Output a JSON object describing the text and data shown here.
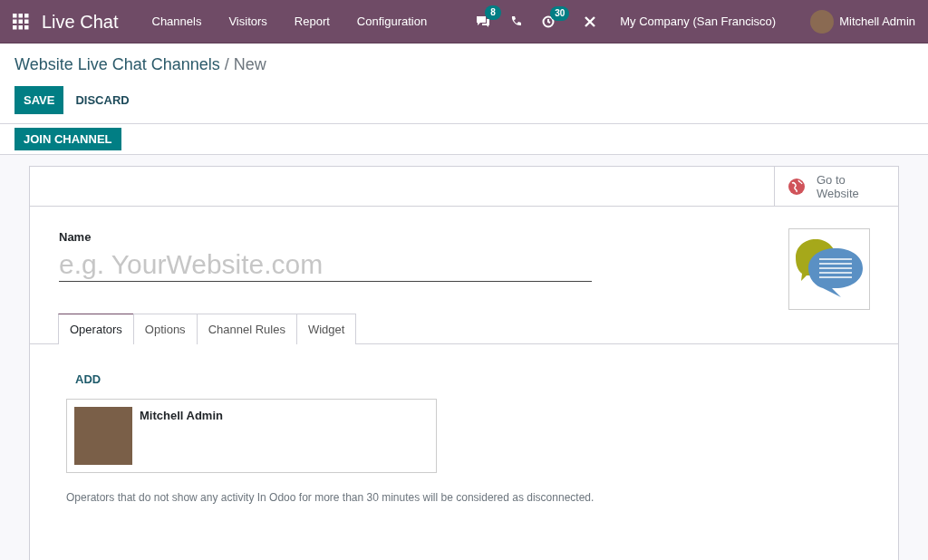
{
  "navbar": {
    "app_title": "Live Chat",
    "menu": [
      "Channels",
      "Visitors",
      "Report",
      "Configuration"
    ],
    "messages_badge": "8",
    "activities_badge": "30",
    "company": "My Company (San Francisco)",
    "user": "Mitchell Admin"
  },
  "breadcrumb": {
    "parent": "Website Live Chat Channels",
    "separator": "/",
    "current": "New"
  },
  "actions": {
    "save": "SAVE",
    "discard": "DISCARD"
  },
  "header_button": "JOIN CHANNEL",
  "smart_button": {
    "line1": "Go to",
    "line2": "Website"
  },
  "form": {
    "name_label": "Name",
    "name_placeholder": "e.g. YourWebsite.com"
  },
  "tabs": [
    {
      "label": "Operators",
      "selected": true
    },
    {
      "label": "Options",
      "selected": false
    },
    {
      "label": "Channel Rules",
      "selected": false
    },
    {
      "label": "Widget",
      "selected": false
    }
  ],
  "operators_tab": {
    "add": "ADD",
    "operators": [
      {
        "name": "Mitchell Admin"
      }
    ],
    "help": "Operators that do not show any activity In Odoo for more than 30 minutes will be considered as disconnected."
  }
}
